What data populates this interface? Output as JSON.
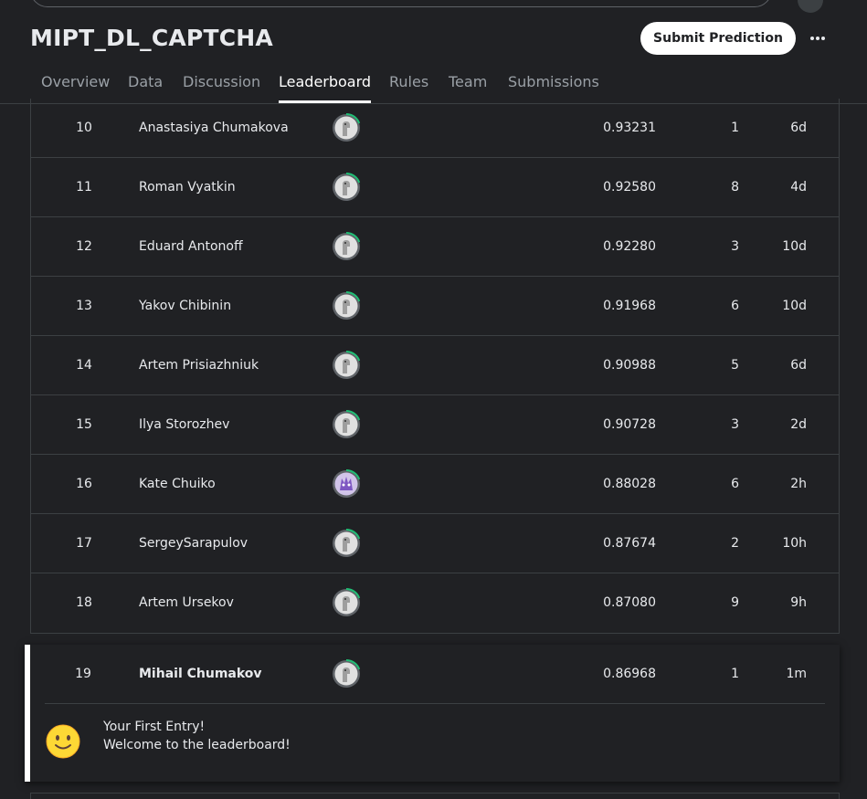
{
  "competition": {
    "title": "MIPT_DL_CAPTCHA",
    "submit_label": "Submit Prediction",
    "more_icon": "more-horizontal-icon"
  },
  "tabs": [
    {
      "label": "Overview",
      "active": false
    },
    {
      "label": "Data",
      "active": false
    },
    {
      "label": "Discussion",
      "active": false
    },
    {
      "label": "Leaderboard",
      "active": true
    },
    {
      "label": "Rules",
      "active": false
    },
    {
      "label": "Team",
      "active": false
    },
    {
      "label": "Submissions",
      "active": false
    }
  ],
  "rows": [
    {
      "rank": "10",
      "name": "Anastasiya Chumakova",
      "score": "0.93231",
      "entries": "1",
      "last": "6d",
      "avatar": "novice-avatar-icon"
    },
    {
      "rank": "11",
      "name": "Roman Vyatkin",
      "score": "0.92580",
      "entries": "8",
      "last": "4d",
      "avatar": "novice-avatar-icon"
    },
    {
      "rank": "12",
      "name": "Eduard Antonoff",
      "score": "0.92280",
      "entries": "3",
      "last": "10d",
      "avatar": "novice-avatar-icon"
    },
    {
      "rank": "13",
      "name": "Yakov Chibinin",
      "score": "0.91968",
      "entries": "6",
      "last": "10d",
      "avatar": "novice-avatar-icon"
    },
    {
      "rank": "14",
      "name": "Artem Prisiazhniuk",
      "score": "0.90988",
      "entries": "5",
      "last": "6d",
      "avatar": "novice-avatar-icon"
    },
    {
      "rank": "15",
      "name": "Ilya Storozhev",
      "score": "0.90728",
      "entries": "3",
      "last": "2d",
      "avatar": "novice-avatar-icon"
    },
    {
      "rank": "16",
      "name": "Kate Chuiko",
      "score": "0.88028",
      "entries": "6",
      "last": "2h",
      "avatar": "purple-avatar-icon"
    },
    {
      "rank": "17",
      "name": "SergeySarapulov",
      "score": "0.87674",
      "entries": "2",
      "last": "10h",
      "avatar": "novice-avatar-icon"
    },
    {
      "rank": "18",
      "name": "Artem Ursekov",
      "score": "0.87080",
      "entries": "9",
      "last": "9h",
      "avatar": "novice-avatar-icon"
    }
  ],
  "my_entry": {
    "rank": "19",
    "name": "Mihail Chumakov",
    "score": "0.86968",
    "entries": "1",
    "last": "1m",
    "avatar": "novice-avatar-icon",
    "message_title": "Your First Entry!",
    "message_sub": "Welcome to the leaderboard!",
    "message_icon": "smiley-face-icon"
  },
  "colors": {
    "background": "#202124",
    "border": "#3c4043",
    "text": "#e8eaed",
    "tab_inactive": "#9aa0a6",
    "progress_ring": "#20BE75",
    "purple_avatar": "#7e57c2"
  }
}
